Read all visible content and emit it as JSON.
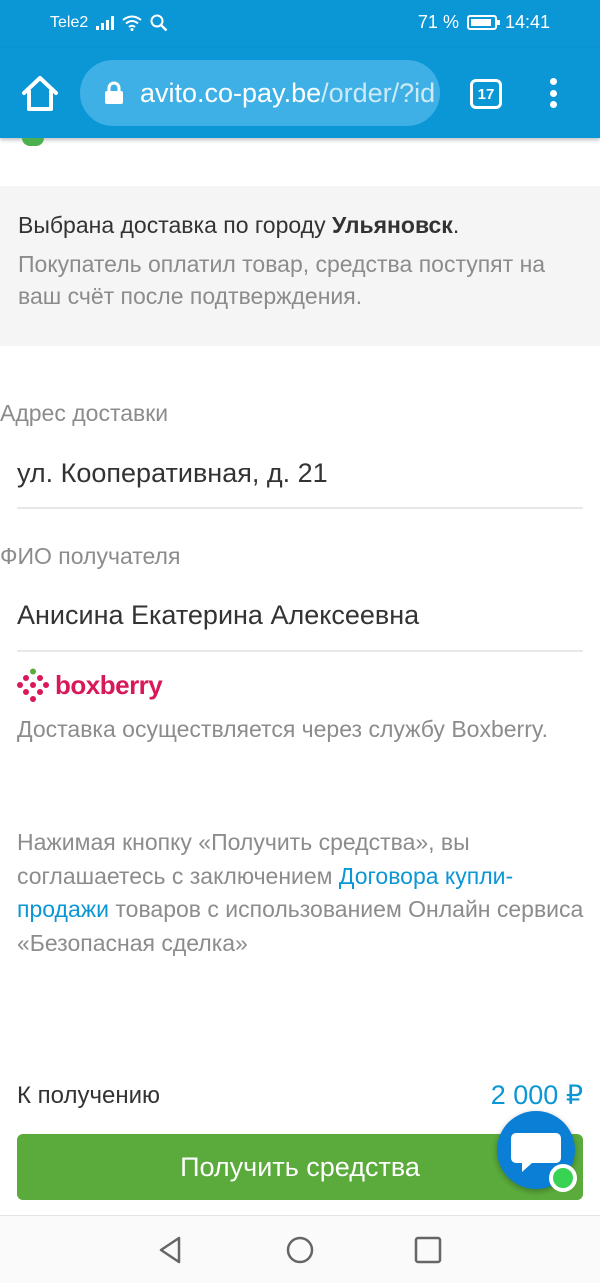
{
  "status_bar": {
    "carrier": "Tele2",
    "battery": "71 %",
    "time": "14:41",
    "icons": [
      "signal-icon",
      "wifi-icon",
      "search-icon",
      "battery-icon"
    ]
  },
  "browser": {
    "url_domain": "avito.co-pay.be",
    "url_path": "/order/?id",
    "tab_count": "17",
    "icons": [
      "home-icon",
      "lock-icon",
      "more-menu-icon"
    ]
  },
  "info": {
    "line1_prefix": "Выбрана доставка по городу ",
    "city": "Ульяновск",
    "line1_suffix": ".",
    "line2": "Покупатель оплатил товар, средства поступят на ваш счёт после подтверждения."
  },
  "address": {
    "label": "Адрес доставки",
    "value": "ул. Кооперативная, д. 21"
  },
  "recipient": {
    "label": "ФИО получателя",
    "value": "Анисина Екатерина Алексеевна"
  },
  "delivery": {
    "brand": "boxberry",
    "text": "Доставка осуществляется через службу Boxberry."
  },
  "agreement": {
    "part1": "Нажимая кнопку «Получить средства», вы соглашаетесь с заключением ",
    "link": "Договора купли-продажи",
    "part2": " товаров с использованием Онлайн сервиса «Безопасная сделка»"
  },
  "payout": {
    "label": "К получению",
    "amount": "2 000 ₽"
  },
  "cta": {
    "label": "Получить средства"
  },
  "colors": {
    "brand_blue": "#0b96d6",
    "cta_green": "#5aaa3c",
    "boxberry_red": "#d8185a"
  }
}
